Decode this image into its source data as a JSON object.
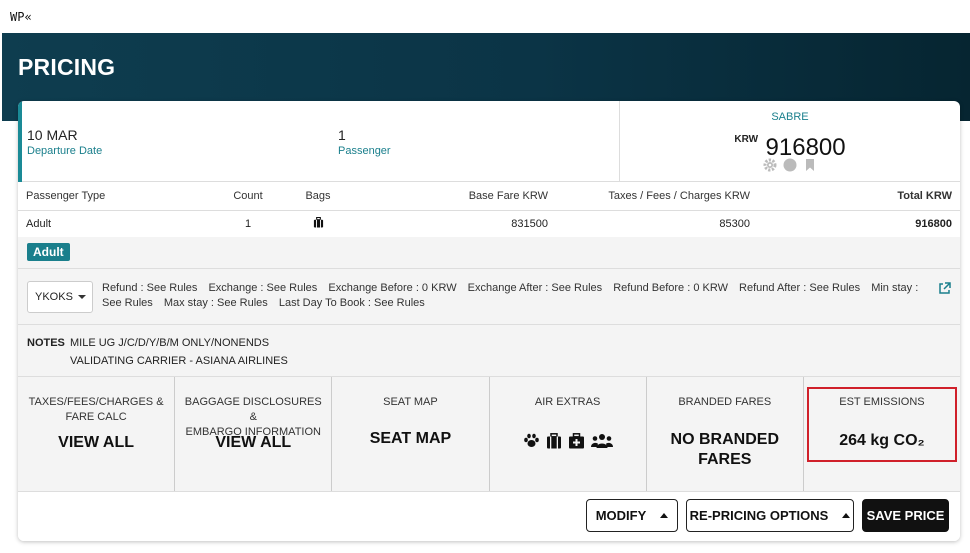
{
  "command_line": "WP«",
  "header": {
    "title": "PRICING"
  },
  "summary": {
    "departure_date": "10 MAR",
    "departure_label": "Departure Date",
    "passenger_count": "1",
    "passenger_label": "Passenger",
    "fare_source": "SABRE",
    "currency": "KRW",
    "total_amount": "916800"
  },
  "pax_table": {
    "headers": [
      "Passenger Type",
      "Count",
      "Bags",
      "Base Fare KRW",
      "Taxes / Fees / Charges KRW",
      "Total KRW"
    ],
    "rows": [
      {
        "type": "Adult",
        "count": "1",
        "bags_icon": "luggage-icon",
        "base_fare": "831500",
        "taxes": "85300",
        "total": "916800"
      }
    ]
  },
  "passenger_badge": "Adult",
  "fare_basis": {
    "selected": "YKOKS"
  },
  "rules": [
    "Refund : See Rules",
    "Exchange : See Rules",
    "Exchange Before : 0 KRW",
    "Exchange After : See Rules",
    "Refund Before : 0 KRW",
    "Refund After : See Rules",
    "Min stay : See Rules",
    "Max stay : See Rules",
    "Last Day To Book : See Rules"
  ],
  "notes": {
    "label": "NOTES",
    "lines": [
      "MILE UG J/C/D/Y/B/M ONLY/NONENDS",
      "VALIDATING CARRIER - ASIANA AIRLINES"
    ]
  },
  "tiles": [
    {
      "title_line1": "TAXES/FEES/CHARGES &",
      "title_line2": "FARE CALC",
      "value": "VIEW ALL"
    },
    {
      "title_line1": "BAGGAGE DISCLOSURES &",
      "title_line2": "EMBARGO INFORMATION",
      "value": "VIEW ALL"
    },
    {
      "title_line1": "SEAT MAP",
      "title_line2": "",
      "value": "SEAT MAP"
    },
    {
      "title_line1": "AIR EXTRAS",
      "title_line2": "",
      "icons": [
        "paw-icon",
        "suitcase-icon",
        "medical-bag-icon",
        "group-icon"
      ]
    },
    {
      "title_line1": "BRANDED FARES",
      "title_line2": "",
      "value_line1": "NO BRANDED",
      "value_line2": "FARES"
    },
    {
      "title_line1": "EST EMISSIONS",
      "title_line2": "",
      "value": "264 kg CO₂"
    }
  ],
  "actions": {
    "modify": "MODIFY",
    "repricing": "RE-PRICING OPTIONS",
    "save": "SAVE PRICE"
  },
  "colors": {
    "accent": "#1a7f8c",
    "header_bg": "#0b3446",
    "highlight": "#d0202a"
  }
}
